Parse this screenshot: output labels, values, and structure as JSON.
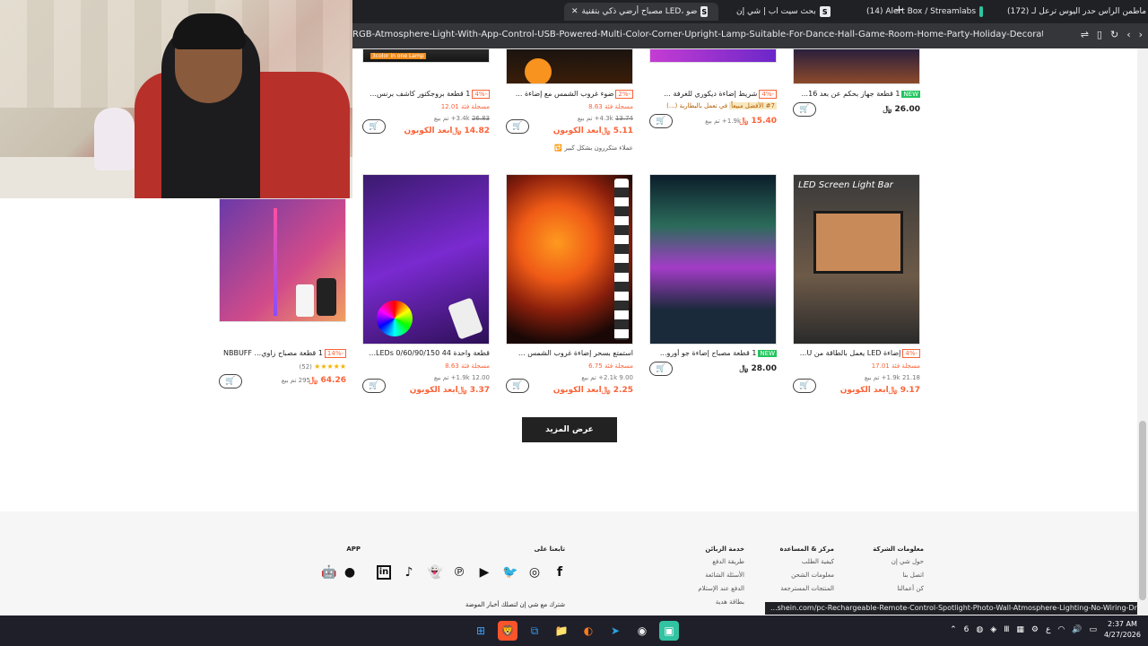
{
  "browser": {
    "tabs": [
      {
        "title": "(172) ماطمن الراس حدر اليوس ترعل لـ",
        "fav_color": "#ff0033"
      },
      {
        "title": "(14) Alert Box / Streamlabs",
        "fav_color": "#31c3a2"
      },
      {
        "title": "بحث سيت اب | شي إن",
        "fav_letter": "S"
      },
      {
        "title": "مصباح أرضي ذكي بتقنية LED، ضو",
        "fav_letter": "S"
      }
    ],
    "url": "RGB-Atmosphere-Light-With-App-Control-USB-Powered-Multi-Color-Corner-Upright-Lamp-Suitable-For-Dance-Hall-Game-Room-Home-Party-Holiday-Decoration-Living-Room-Decor-Li...",
    "status_url": "...shein.com/pc-Rechargeable-Remote-Control-Spotlight-Photo-Wall-Atmosphere-Lighting-No-Wiring-Drilling-On"
  },
  "top_products": [
    {
      "title": "1 قطعة بروجكتور كاشف برنس...",
      "discount": "-4%",
      "coupon_line": "مسجلة فئة 12.01",
      "sold": "3.4k+ تم بيع",
      "old_price": "26.83",
      "price": "14.82 ﷼ابعد الكوبون",
      "image_caption": "3color in one Lamp"
    },
    {
      "title": "ضوء غروب الشمس مع إضاءة ...",
      "discount": "-2%",
      "coupon_line": "مسجلة فئة 8.63",
      "sold": "4.3k+ تم بيع",
      "old_price": "13.74",
      "price": "5.11 ﷼ابعد الكوبون",
      "note": "عملاء متكررون بشكل كبير 🔁"
    },
    {
      "title": "شريط إضاءة ديكوري للغرفة ...",
      "discount": "-4%",
      "best": "#7 الأفضل مبيعاً",
      "best_sub": "في تعمل بالبطارية (...)",
      "sold": "1.9k+ تم بيع",
      "price": "15.40 ﷼"
    },
    {
      "title": "1 قطعة جهاز بحكم عن بعد 16...",
      "new_badge": "NEW",
      "price": "26.00 ﷼"
    }
  ],
  "products": [
    {
      "title": "1 قطعة مصباح زاوي... NBBUFF",
      "discount": "-14%",
      "rating": "★★★★★",
      "reviews": "(52)",
      "sold": "295 تم بيع",
      "price": "64.26 ﷼"
    },
    {
      "title": "قطعة واحدة 44 LEDs 0/60/90/150...",
      "coupon_line": "مسجلة فئة 8.63",
      "sold": "1.9k+ تم بيع",
      "old_price": "12.00",
      "price": "3.37 ﷼ابعد الكوبون"
    },
    {
      "title": "استمتع بسحر إضاءة غروب الشمس ...",
      "coupon_line": "مسجلة فئة 6.75",
      "sold": "2.1k+ تم بيع",
      "old_price": "9.00",
      "price": "2.25 ﷼ابعد الكوبون"
    },
    {
      "title": "1 قطعة مصباح إضاءة جو أورو...",
      "new_badge": "NEW",
      "price": "28.00 ﷼"
    },
    {
      "title": "إضاءة LED يعمل بالطاقة من U...",
      "discount": "-4%",
      "coupon_line": "مسجلة فئة 17.01",
      "sold": "1.9k+ تم بيع",
      "old_price": "21.18",
      "price": "9.17 ﷼ابعد الكوبون",
      "image_caption": "LED Screen Light Bar"
    }
  ],
  "more_button": "عرض المزيد",
  "footer": {
    "company": {
      "heading": "معلومات الشركة",
      "items": [
        "حول شي إن",
        "اتصل بنا",
        "كن أعمالنا"
      ]
    },
    "help": {
      "heading": "مركز & المساعدة",
      "items": [
        "كيفية الطلب",
        "معلومات الشحن",
        "المنتجات المسترجعة"
      ]
    },
    "service": {
      "heading": "خدمة الزبائن",
      "items": [
        "طريقة الدفع",
        "الأسئلة الشائعة",
        "الدفع عند الإستلام",
        "بطاقة هدية"
      ]
    },
    "follow": {
      "heading": "تابعنا على"
    },
    "app": {
      "heading": "APP"
    },
    "newsletter": "شترك مع شي إن لتصلك أخبار الموضة"
  },
  "taskbar": {
    "time": "2:37 AM",
    "date": "4/27/2026",
    "lang": "ع"
  },
  "colors": {
    "accent": "#fa6338",
    "new_badge": "#22c55e"
  }
}
